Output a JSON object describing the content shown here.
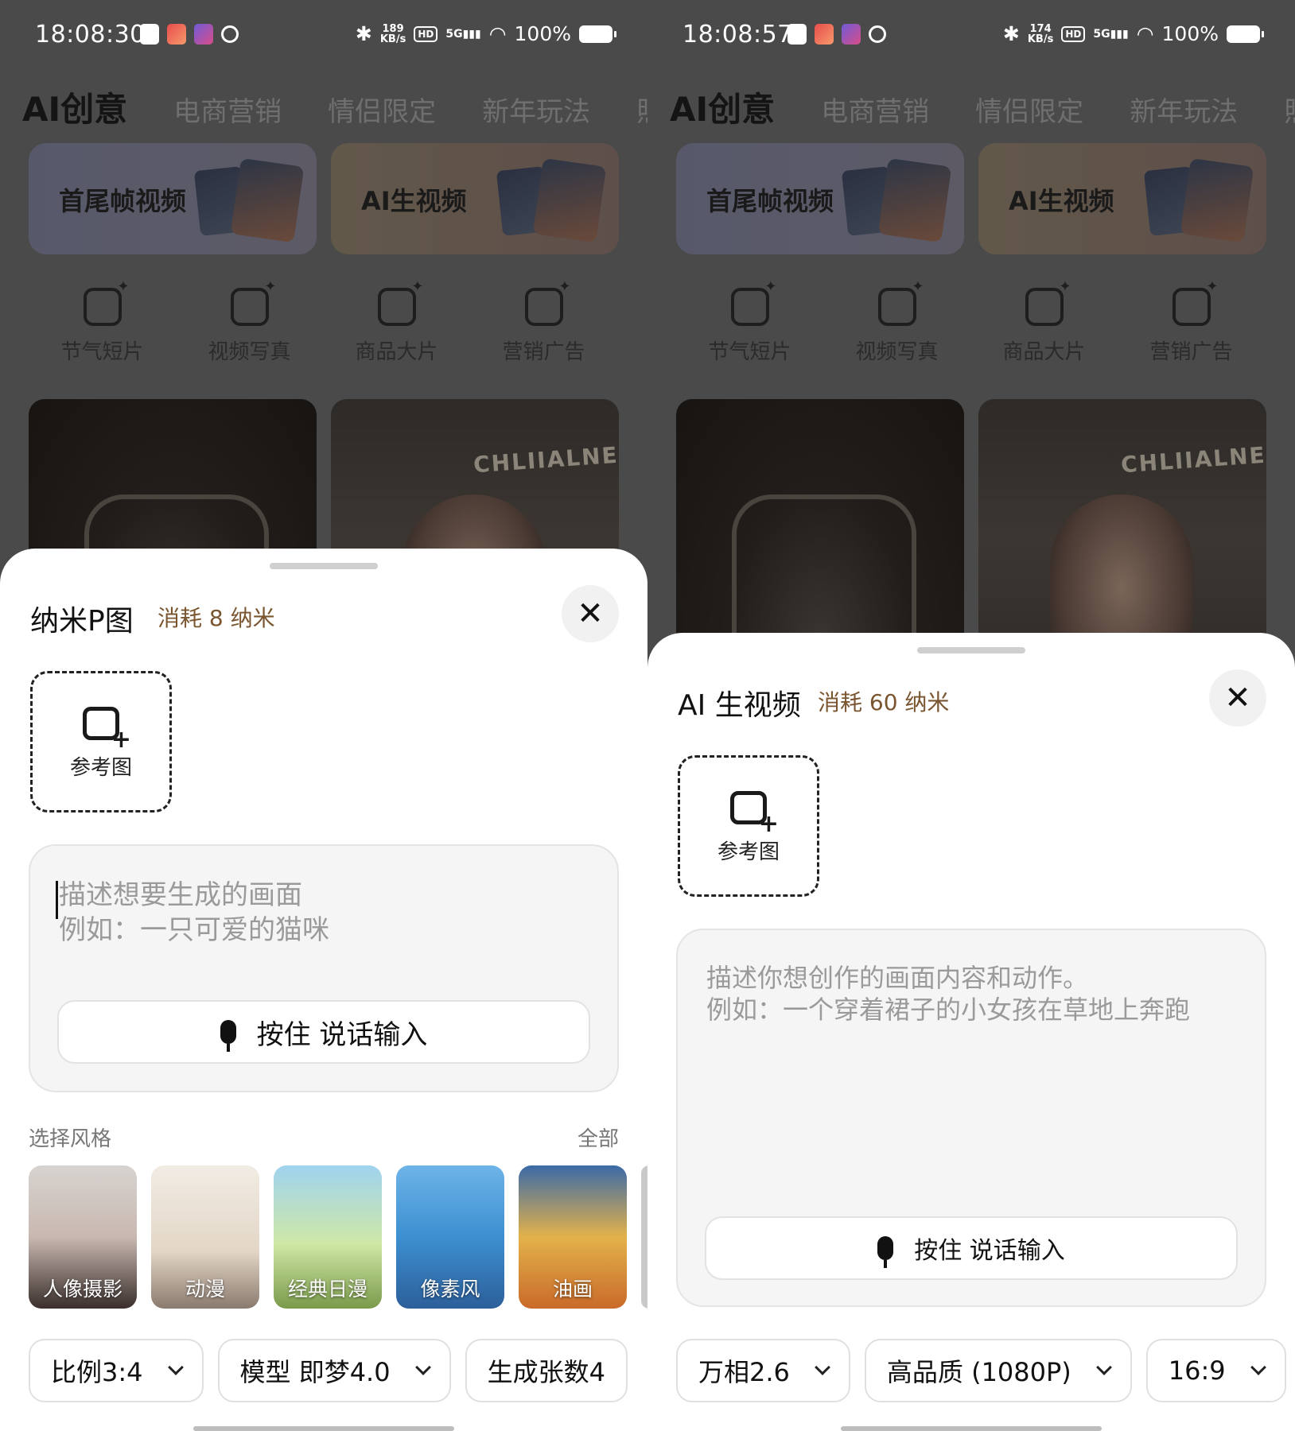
{
  "left": {
    "status": {
      "time": "18:08:30",
      "speed_top": "189",
      "speed_bottom": "KB/s",
      "hd": "HD",
      "sig": "5G",
      "battery": "100%"
    },
    "tabs": [
      "AI创意",
      "电商营销",
      "情侣限定",
      "新年玩法",
      "照"
    ],
    "cards": [
      "首尾帧视频",
      "AI生视频"
    ],
    "quick": [
      "节气短片",
      "视频写真",
      "商品大片",
      "营销广告"
    ],
    "photo_sign": "CHLIIALNE",
    "sheet": {
      "title": "纳米P图",
      "cost": "消耗 8 纳米",
      "close": "✕",
      "ref_label": "参考图",
      "placeholder": "描述想要生成的画面\n例如：一只可爱的猫咪",
      "voice": "按住 说话输入",
      "style_title": "选择风格",
      "style_all": "全部",
      "styles": [
        "人像摄影",
        "动漫",
        "经典日漫",
        "像素风",
        "油画"
      ],
      "pills": [
        "比例3:4",
        "模型 即梦4.0",
        "生成张数4"
      ]
    }
  },
  "right": {
    "status": {
      "time": "18:08:57",
      "speed_top": "174",
      "speed_bottom": "KB/s",
      "hd": "HD",
      "sig": "5G",
      "battery": "100%"
    },
    "tabs": [
      "AI创意",
      "电商营销",
      "情侣限定",
      "新年玩法",
      "照"
    ],
    "cards": [
      "首尾帧视频",
      "AI生视频"
    ],
    "quick": [
      "节气短片",
      "视频写真",
      "商品大片",
      "营销广告"
    ],
    "photo_sign": "CHLIIALNE",
    "sheet": {
      "title": "AI 生视频",
      "cost": "消耗 60 纳米",
      "close": "✕",
      "ref_label": "参考图",
      "placeholder": "描述你想创作的画面内容和动作。\n例如：一个穿着裙子的小女孩在草地上奔跑",
      "voice": "按住 说话输入",
      "pills": [
        "万相2.6",
        "高品质 (1080P)",
        "16:9"
      ]
    }
  }
}
